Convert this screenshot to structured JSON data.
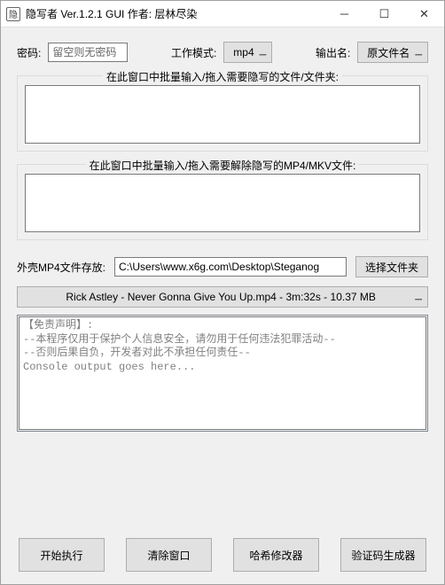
{
  "window": {
    "title": "隐写者 Ver.1.2.1 GUI 作者: 层林尽染",
    "app_icon_glyph": "隐"
  },
  "toolbar": {
    "password_label": "密码:",
    "password_placeholder": "留空则无密码",
    "password_value": "",
    "mode_label": "工作模式:",
    "mode_value": "mp4",
    "output_label": "输出名:",
    "output_value": "原文件名"
  },
  "groups": {
    "hide_legend": "在此窗口中批量输入/拖入需要隐写的文件/文件夹:",
    "reveal_legend": "在此窗口中批量输入/拖入需要解除隐写的MP4/MKV文件:"
  },
  "shell": {
    "label": "外壳MP4文件存放:",
    "path": "C:\\Users\\www.x6g.com\\Desktop\\Steganog",
    "choose_btn": "选择文件夹",
    "file_display": "Rick Astley - Never Gonna Give You Up.mp4 - 3m:32s - 10.37 MB"
  },
  "console": {
    "text": "【免责声明】:\n--本程序仅用于保护个人信息安全，请勿用于任何违法犯罪活动--\n--否则后果自负，开发者对此不承担任何责任--\nConsole output goes here..."
  },
  "buttons": {
    "start": "开始执行",
    "clear": "清除窗口",
    "hash": "哈希修改器",
    "captcha": "验证码生成器"
  }
}
